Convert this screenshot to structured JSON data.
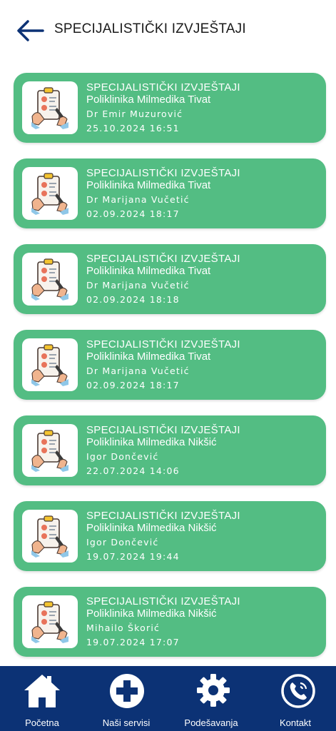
{
  "header": {
    "title": "SPECIJALISTIČKI IZVJEŠTAJI",
    "back_icon": "arrow-left-icon"
  },
  "reports": [
    {
      "type": "SPECIJALISTIČKI IZVJEŠTAJI",
      "clinic": "Poliklinika Milmedika Tivat",
      "doctor": "Dr Emir Muzurović",
      "datetime": "25.10.2024 16:51"
    },
    {
      "type": "SPECIJALISTIČKI IZVJEŠTAJI",
      "clinic": "Poliklinika Milmedika Tivat",
      "doctor": "Dr Marijana Vučetić",
      "datetime": "02.09.2024 18:17"
    },
    {
      "type": "SPECIJALISTIČKI IZVJEŠTAJI",
      "clinic": "Poliklinika Milmedika Tivat",
      "doctor": "Dr Marijana Vučetić",
      "datetime": "02.09.2024 18:18"
    },
    {
      "type": "SPECIJALISTIČKI IZVJEŠTAJI",
      "clinic": "Poliklinika Milmedika Tivat",
      "doctor": "Dr Marijana Vučetić",
      "datetime": "02.09.2024 18:17"
    },
    {
      "type": "SPECIJALISTIČKI IZVJEŠTAJI",
      "clinic": "Poliklinika Milmedika Nikšić",
      "doctor": "Igor Dončević",
      "datetime": "22.07.2024 14:06"
    },
    {
      "type": "SPECIJALISTIČKI IZVJEŠTAJI",
      "clinic": "Poliklinika Milmedika Nikšić",
      "doctor": "Igor Dončević",
      "datetime": "19.07.2024 19:44"
    },
    {
      "type": "SPECIJALISTIČKI IZVJEŠTAJI",
      "clinic": "Poliklinika Milmedika Nikšić",
      "doctor": "Mihailo Škorić",
      "datetime": "19.07.2024 17:07"
    }
  ],
  "nav": {
    "items": [
      {
        "label": "Početna",
        "icon": "home-icon"
      },
      {
        "label": "Naši servisi",
        "icon": "medical-cross-icon"
      },
      {
        "label": "Podešavanja",
        "icon": "gear-icon"
      },
      {
        "label": "Kontakt",
        "icon": "phone-icon"
      }
    ]
  },
  "colors": {
    "card": "#53bd83",
    "nav": "#0c3275",
    "text_dark": "#1a1a1a"
  }
}
